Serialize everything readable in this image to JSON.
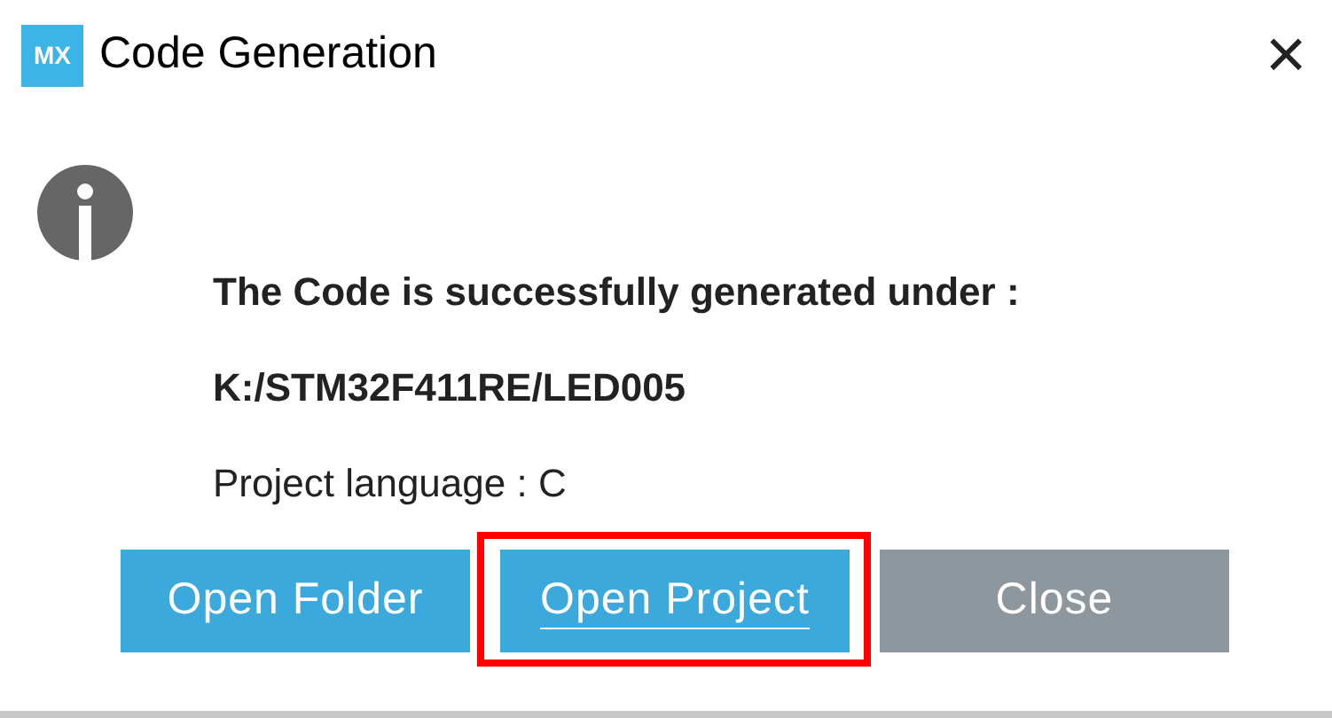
{
  "window": {
    "logo": "MX",
    "title": "Code Generation",
    "close": "×"
  },
  "message": {
    "heading": "The Code is successfully generated under :",
    "path": "K:/STM32F411RE/LED005",
    "language": "Project language : C"
  },
  "buttons": [
    {
      "label": "Open Folder",
      "kind": "primary",
      "focused": false,
      "highlighted": false
    },
    {
      "label": "Open Project",
      "kind": "primary",
      "focused": true,
      "highlighted": true
    },
    {
      "label": "Close",
      "kind": "secondary",
      "focused": false,
      "highlighted": false
    }
  ]
}
